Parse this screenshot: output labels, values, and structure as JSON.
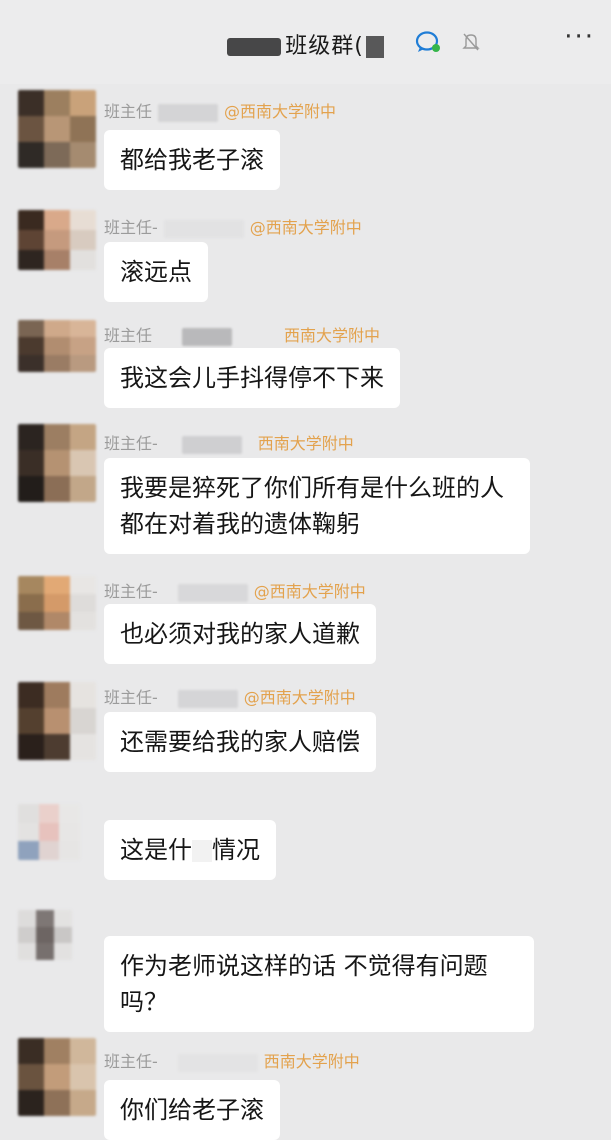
{
  "header": {
    "title": "班级群(",
    "chat_icon": "chat-bubble-icon",
    "bell_icon": "muted-bell-icon",
    "more_icon": "more-icon",
    "more": "···"
  },
  "messages": [
    {
      "sender": "班主任",
      "org": "@西南大学附中",
      "text": "都给我老子滚"
    },
    {
      "sender": "班主任-",
      "org": "@西南大学附中",
      "text": "滚远点"
    },
    {
      "sender": "班主任",
      "org": "西南大学附中",
      "text": "我这会儿手抖得停不下来"
    },
    {
      "sender": "班主任-",
      "org": "西南大学附中",
      "text": "我要是猝死了你们所有是什么班的人都在对着我的遗体鞠躬"
    },
    {
      "sender": "班主任-",
      "org": "@西南大学附中",
      "text": "也必须对我的家人道歉"
    },
    {
      "sender": "班主任-",
      "org": "@西南大学附中",
      "text": "还需要给我的家人赔偿"
    },
    {
      "sender": "",
      "org": "",
      "text_a": "这是什",
      "text_b": "情况"
    },
    {
      "sender": "",
      "org": "",
      "text": "作为老师说这样的话 不觉得有问题吗？"
    },
    {
      "sender": "班主任-",
      "org": "西南大学附中",
      "text": "你们给老子滚"
    }
  ],
  "colors": {
    "background": "#e9e9ea",
    "bubble": "#ffffff",
    "org_tag": "#e3a24d",
    "sender": "#9b9b9b"
  }
}
